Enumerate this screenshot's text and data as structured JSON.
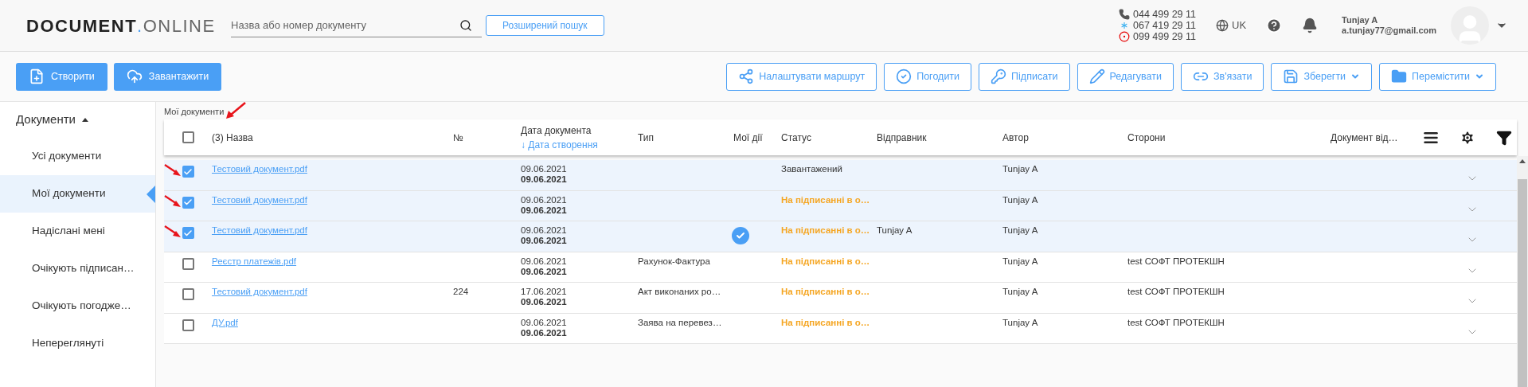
{
  "header": {
    "logo": {
      "bold": "DOCUMENT",
      "dot": ".",
      "light": "ONLINE"
    },
    "search": {
      "placeholder": "Назва або номер документу"
    },
    "advanced_search": "Розширений пошук",
    "phones": [
      {
        "kind": "landline",
        "number": "044 499 29 11"
      },
      {
        "kind": "kyivstar",
        "number": "067 419 29 11"
      },
      {
        "kind": "vodafone",
        "number": "099 499 29 11"
      }
    ],
    "language": "UK",
    "user": {
      "name": "Tunjay A",
      "email": "a.tunjay77@gmail.com"
    }
  },
  "toolbar": {
    "left": [
      {
        "kind": "create",
        "label": "Створити"
      },
      {
        "kind": "upload",
        "label": "Завантажити"
      }
    ],
    "right": [
      {
        "kind": "route",
        "label": "Налаштувати маршрут",
        "dropdown": false
      },
      {
        "kind": "approve",
        "label": "Погодити",
        "dropdown": false
      },
      {
        "kind": "sign",
        "label": "Підписати",
        "dropdown": false
      },
      {
        "kind": "edit",
        "label": "Редагувати",
        "dropdown": false
      },
      {
        "kind": "link",
        "label": "Зв'язати",
        "dropdown": false
      },
      {
        "kind": "save",
        "label": "Зберегти",
        "dropdown": true
      },
      {
        "kind": "move",
        "label": "Перемістити",
        "dropdown": true
      }
    ]
  },
  "sidebar": {
    "section": "Документи",
    "expanded": true,
    "items": [
      {
        "label": "Усі документи",
        "selected": false
      },
      {
        "label": "Мої документи",
        "selected": true
      },
      {
        "label": "Надіслані мені",
        "selected": false
      },
      {
        "label": "Очікують підписан…",
        "selected": false
      },
      {
        "label": "Очікують погодже…",
        "selected": false
      },
      {
        "label": "Непереглянуті",
        "selected": false
      }
    ]
  },
  "breadcrumb": "Мої документи",
  "table": {
    "all_checked": false,
    "columns": {
      "name": "(3) Назва",
      "number": "№",
      "date": "Дата документа",
      "date_sort": "↓ Дата створення",
      "type": "Тип",
      "my_actions": "Мої дії",
      "status": "Статус",
      "sender": "Відправник",
      "author": "Автор",
      "parties": "Сторони",
      "doc": "Документ від…"
    },
    "rows": [
      {
        "checked": true,
        "annotated": true,
        "name": "Тестовий документ.pdf",
        "number": "",
        "date": "09.06.2021",
        "created": "09.06.2021",
        "type": "",
        "approved": false,
        "status": "Завантажений",
        "pending": false,
        "sender": "",
        "author": "Tunjay A",
        "parties": ""
      },
      {
        "checked": true,
        "annotated": true,
        "name": "Тестовий документ.pdf",
        "number": "",
        "date": "09.06.2021",
        "created": "09.06.2021",
        "type": "",
        "approved": false,
        "status": "На підписанні в о…",
        "pending": true,
        "sender": "",
        "author": "Tunjay A",
        "parties": ""
      },
      {
        "checked": true,
        "annotated": true,
        "name": "Тестовий документ.pdf",
        "number": "",
        "date": "09.06.2021",
        "created": "09.06.2021",
        "type": "",
        "approved": true,
        "status": "На підписанні в о…",
        "pending": true,
        "sender": "Tunjay A",
        "author": "Tunjay A",
        "parties": ""
      },
      {
        "checked": false,
        "annotated": false,
        "name": "Реєстр платежів.pdf",
        "number": "",
        "date": "09.06.2021",
        "created": "09.06.2021",
        "type": "Рахунок-Фактура",
        "approved": false,
        "status": "На підписанні в о…",
        "pending": true,
        "sender": "",
        "author": "Tunjay A",
        "parties": "test СОФТ ПРОТЕКШН"
      },
      {
        "checked": false,
        "annotated": false,
        "name": "Тестовий документ.pdf",
        "number": "224",
        "date": "17.06.2021",
        "created": "09.06.2021",
        "type": "Акт виконаних ро…",
        "approved": false,
        "status": "На підписанні в о…",
        "pending": true,
        "sender": "",
        "author": "Tunjay A",
        "parties": "test СОФТ ПРОТЕКШН"
      },
      {
        "checked": false,
        "annotated": false,
        "name": "ДУ.pdf",
        "number": "",
        "date": "09.06.2021",
        "created": "09.06.2021",
        "type": "Заява на перевез…",
        "approved": false,
        "status": "На підписанні в о…",
        "pending": true,
        "sender": "",
        "author": "Tunjay A",
        "parties": "test СОФТ ПРОТЕКШН"
      }
    ]
  }
}
